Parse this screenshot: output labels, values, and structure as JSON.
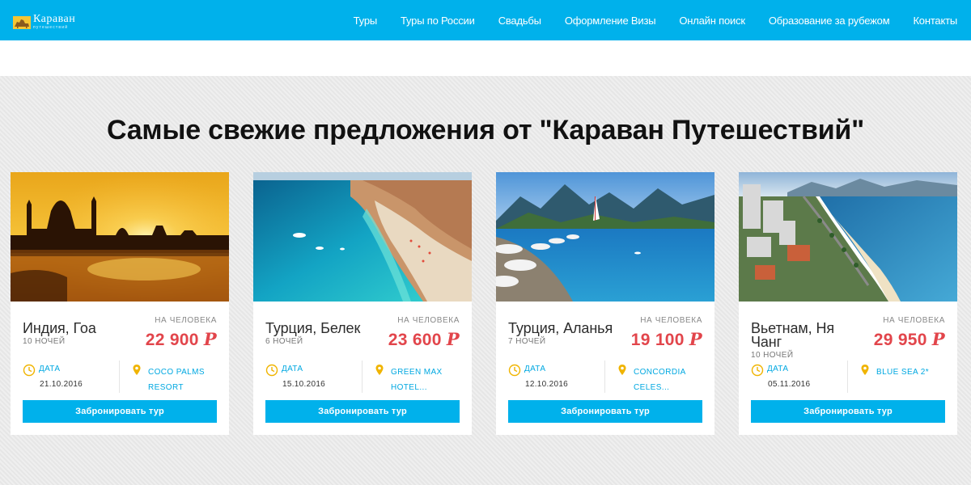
{
  "brand": {
    "name": "Караван",
    "subtitle": "путешествий",
    "color": "#00b1eb"
  },
  "nav": {
    "items": [
      "Туры",
      "Туры по России",
      "Свадьбы",
      "Оформление Визы",
      "Онлайн поиск",
      "Образование за рубежом",
      "Контакты"
    ]
  },
  "main": {
    "headline": "Самые свежие предложения от \"Караван Путешествий\""
  },
  "colors": {
    "price": "#e2454b",
    "accent": "#00b1eb",
    "link": "#00a8e1"
  },
  "cards": [
    {
      "destination": "Индия, Гоа",
      "nights": "10 ночей",
      "per_person": "На человека",
      "price": "22 900",
      "currency": "Р",
      "date_label": "Дата",
      "date": "21.10.2016",
      "hotel": "COCO PALMS RESORT",
      "button": "Забронировать тур",
      "image": "taj-mahal-sunset"
    },
    {
      "destination": "Турция, Белек",
      "nights": "6 ночей",
      "per_person": "На человека",
      "price": "23 600",
      "currency": "Р",
      "date_label": "Дата",
      "date": "15.10.2016",
      "hotel": "GREEN MAX HOTEL...",
      "button": "Забронировать тур",
      "image": "turquoise-beach"
    },
    {
      "destination": "Турция, Аланья",
      "nights": "7 ночей",
      "per_person": "На человека",
      "price": "19 100",
      "currency": "Р",
      "date_label": "Дата",
      "date": "12.10.2016",
      "hotel": "CONCORDIA CELES...",
      "button": "Забронировать тур",
      "image": "mountain-beach-umbrellas"
    },
    {
      "destination": "Вьетнам, Ня Чанг",
      "nights": "10 ночей",
      "per_person": "На человека",
      "price": "29 950",
      "currency": "Р",
      "date_label": "Дата",
      "date": "05.11.2016",
      "hotel": "BLUE SEA 2*",
      "button": "Забронировать тур",
      "image": "coastal-city"
    }
  ]
}
